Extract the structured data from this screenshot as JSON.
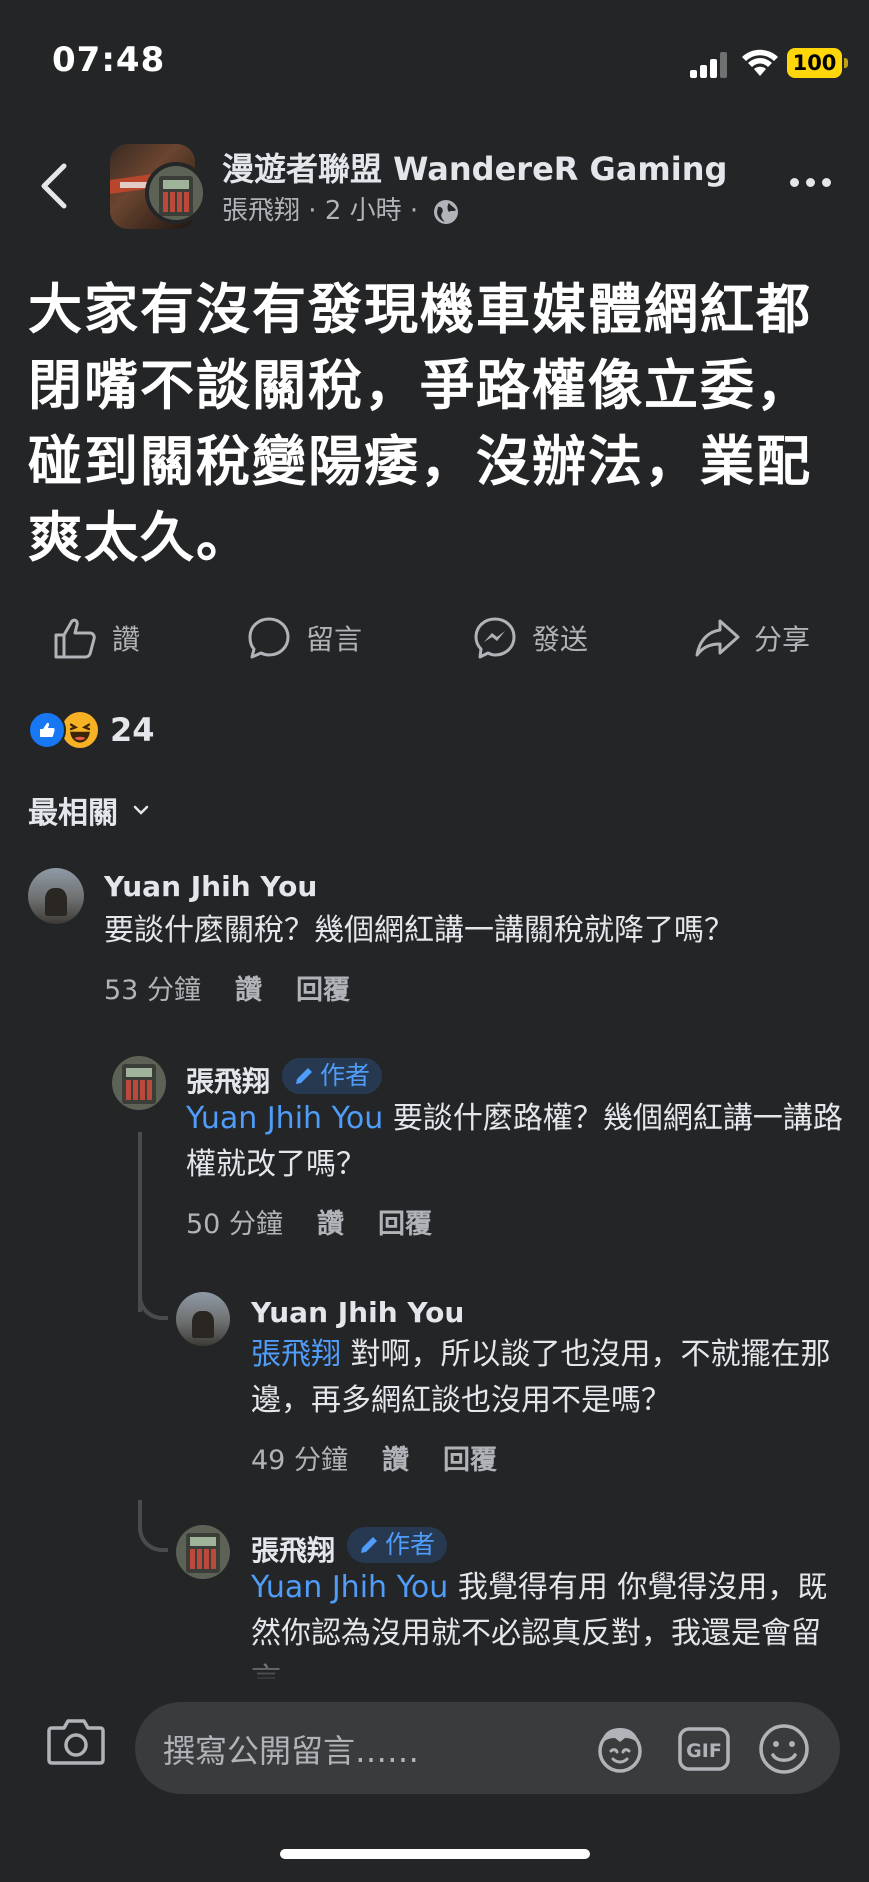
{
  "status": {
    "time": "07:48",
    "battery": "100"
  },
  "header": {
    "group_name": "漫遊者聯盟 WandereR Gaming",
    "author": "張飛翔",
    "time": "2 小時",
    "separator": "·"
  },
  "post": {
    "body": "大家有沒有發現機車媒體網紅都閉嘴不談關稅，爭路權像立委，碰到關稅變陽痿，沒辦法，業配爽太久。"
  },
  "actions": {
    "like": "讚",
    "comment": "留言",
    "send": "發送",
    "share": "分享"
  },
  "reactions": {
    "count": "24"
  },
  "sort": {
    "label": "最相關"
  },
  "comments": [
    {
      "name": "Yuan Jhih You",
      "mention": "",
      "text": "要談什麼關稅？幾個網紅講一講關稅就降了嗎？",
      "time": "53 分鐘",
      "like": "讚",
      "reply": "回覆"
    },
    {
      "name": "張飛翔",
      "badge": "作者",
      "mention": "Yuan Jhih You",
      "text": " 要談什麼路權？幾個網紅講一講路權就改了嗎？",
      "time": "50 分鐘",
      "like": "讚",
      "reply": "回覆"
    },
    {
      "name": "Yuan Jhih You",
      "mention": "張飛翔",
      "text": " 對啊，所以談了也沒用，不就擺在那邊，再多網紅談也沒用不是嗎？",
      "time": "49 分鐘",
      "like": "讚",
      "reply": "回覆"
    },
    {
      "name": "張飛翔",
      "badge": "作者",
      "mention": "Yuan Jhih You",
      "text": " 我覺得有用 你覺得沒用，既然你認為沒用就不必認真反對，我還是會留言。"
    }
  ],
  "composer": {
    "placeholder": "撰寫公開留言……"
  }
}
